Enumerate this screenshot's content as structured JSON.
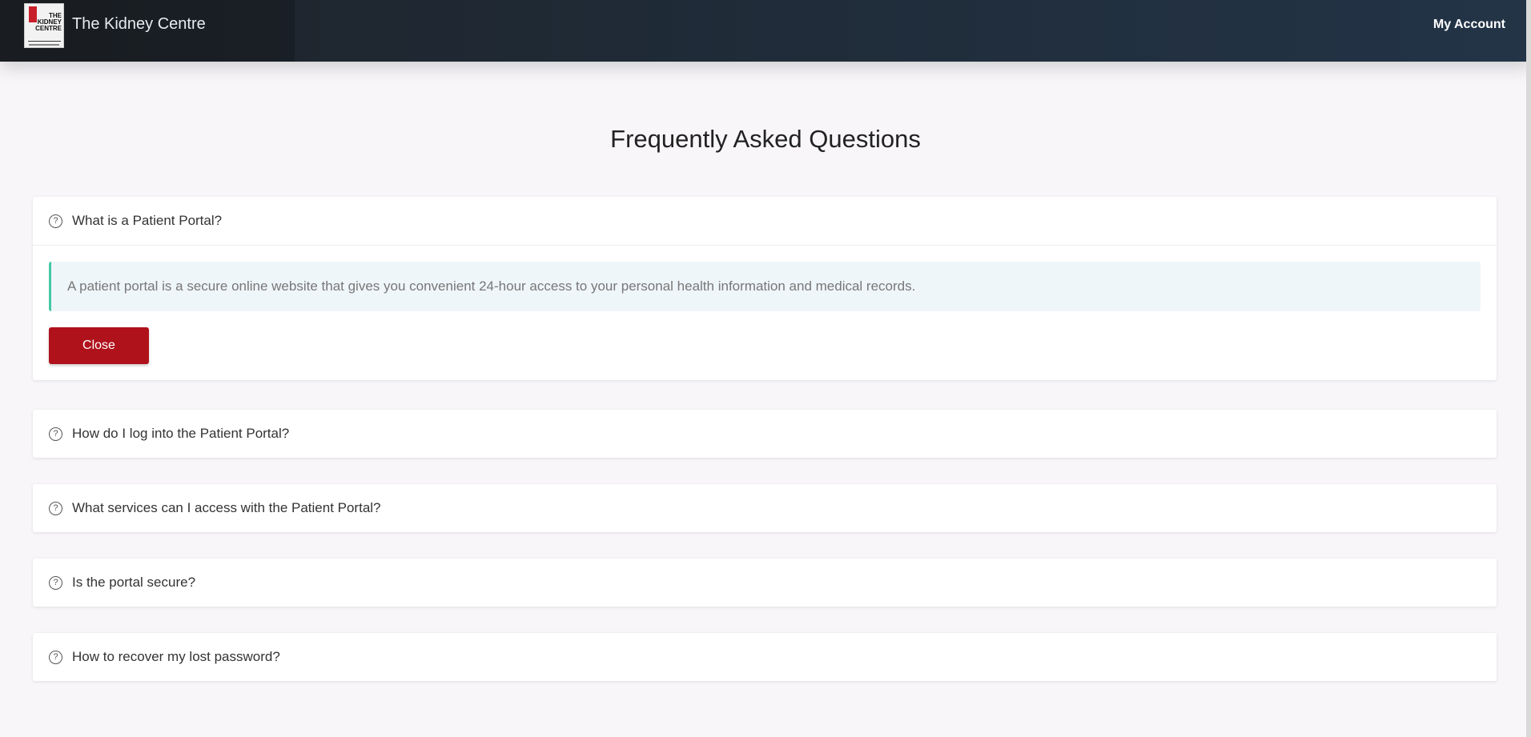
{
  "header": {
    "brand": "The Kidney Centre",
    "logo_lines": [
      "THE",
      "KIDNEY",
      "CENTRE"
    ],
    "account_link": "My Account"
  },
  "page": {
    "title": "Frequently Asked Questions"
  },
  "faq": [
    {
      "question": "What is a Patient Portal?",
      "expanded": true,
      "answer": "A patient portal is a secure online website that gives you convenient 24-hour access to your personal health information and medical records.",
      "close_label": "Close"
    },
    {
      "question": "How do I log into the Patient Portal?",
      "expanded": false
    },
    {
      "question": "What services can I access with the Patient Portal?",
      "expanded": false
    },
    {
      "question": "Is the portal secure?",
      "expanded": false
    },
    {
      "question": "How to recover my lost password?",
      "expanded": false
    }
  ],
  "icons": {
    "faq_item": "question-circle-icon"
  },
  "colors": {
    "navbar": "#1f2a36",
    "close_button": "#b0121b",
    "answer_accent": "#45c7a5",
    "answer_bg": "#eff6fa"
  }
}
